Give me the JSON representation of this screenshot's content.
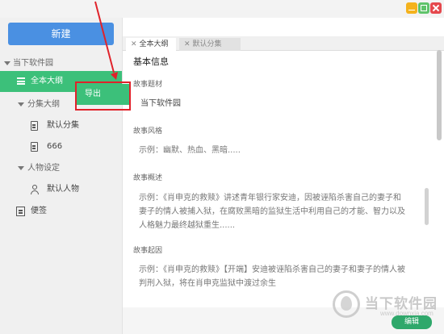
{
  "window": {
    "controls": [
      "minimize",
      "maximize",
      "close"
    ]
  },
  "sidebar": {
    "new_button": "新建",
    "root": "当下软件园",
    "items": {
      "full_outline": "全本大纲",
      "episode_outline": "分集大纲",
      "default_episode": "默认分集",
      "episode_666": "666",
      "character_settings": "人物设定",
      "default_character": "默认人物",
      "notes": "便签"
    }
  },
  "context_menu": {
    "export": "导出"
  },
  "tabs": [
    {
      "label": "全本大纲",
      "close": "✕"
    },
    {
      "label": "默认分集",
      "close": "✕"
    }
  ],
  "content": {
    "section_title": "基本信息",
    "fields": [
      {
        "label": "故事题材",
        "value": "当下软件园"
      },
      {
        "label": "故事风格",
        "value": "示例：幽默、热血、黑暗....."
      },
      {
        "label": "故事概述",
        "value_lines": [
          "示例：《肖申克的救赎》讲述青年银行家安迪，因被诬陷杀害自己的妻子和",
          "妻子的情人被捕入狱，在腐败黑暗的监狱生活中利用自己的才能、智力以及",
          "人格魅力最终越狱重生......"
        ]
      },
      {
        "label": "故事起因",
        "value_lines": [
          "示例：《肖申克的救赎》【开端】安迪被诬陷杀害自己的妻子和妻子的情人被",
          "判刑入狱，将在肖申克监狱中渡过余生"
        ]
      }
    ]
  },
  "footer": {
    "edit_button": "编辑"
  },
  "watermark": {
    "text": "当下软件园",
    "url": "www.downxia.com"
  },
  "colors": {
    "accent_green": "#3cc07a",
    "new_button_blue": "#4a90e2",
    "highlight_red": "#e0222a"
  }
}
